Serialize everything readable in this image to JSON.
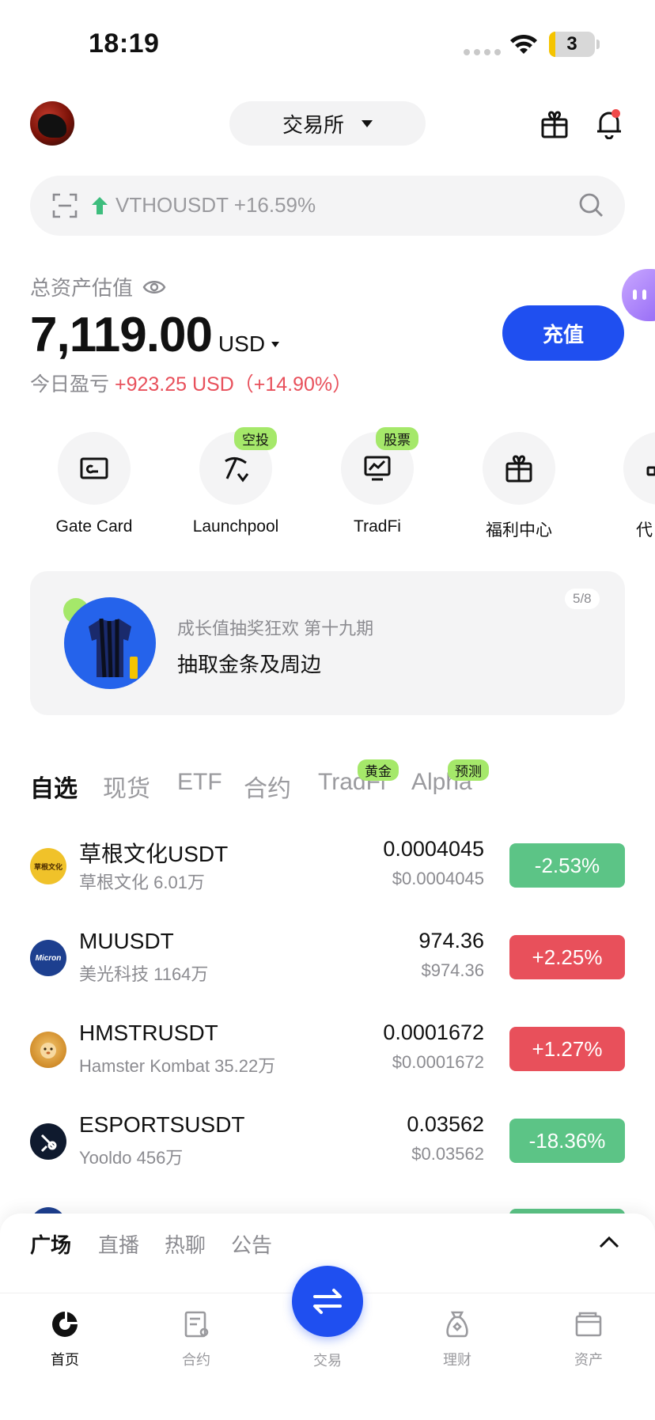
{
  "status_bar": {
    "time": "18:19",
    "battery": "3"
  },
  "header": {
    "exchange_label": "交易所"
  },
  "search": {
    "trending_text": "VTHOUSDT +16.59%"
  },
  "assets": {
    "label": "总资产估值",
    "amount": "7,119.00",
    "currency": "USD",
    "pnl_label": "今日盈亏",
    "pnl_value": "+923.25 USD（+14.90%）",
    "deposit_label": "充值"
  },
  "shortcuts": [
    {
      "label": "Gate Card",
      "icon": "card-icon",
      "badge": ""
    },
    {
      "label": "Launchpool",
      "icon": "pickaxe-icon",
      "badge": "空投"
    },
    {
      "label": "TradFi",
      "icon": "chart-monitor-icon",
      "badge": "股票"
    },
    {
      "label": "福利中心",
      "icon": "gift-icon",
      "badge": ""
    },
    {
      "label": "代",
      "icon": "grid-icon",
      "badge": ""
    }
  ],
  "banner": {
    "subtitle": "成长值抽奖狂欢 第十九期",
    "title": "抽取金条及周边",
    "pager": "5/8"
  },
  "market_tabs": [
    {
      "label": "自选",
      "badge": ""
    },
    {
      "label": "现货",
      "badge": ""
    },
    {
      "label": "ETF",
      "badge": ""
    },
    {
      "label": "合约",
      "badge": ""
    },
    {
      "label": "TradFi",
      "badge": "黄金"
    },
    {
      "label": "Alpha",
      "badge": "预测"
    }
  ],
  "market_rows": [
    {
      "symbol": "草根文化USDT",
      "sub": "草根文化 6.01万",
      "price": "0.0004045",
      "price_usd": "$0.0004045",
      "change": "-2.53%",
      "logo_text": "草根文化"
    },
    {
      "symbol": "MUUSDT",
      "sub": "美光科技 1164万",
      "price": "974.36",
      "price_usd": "$974.36",
      "change": "+2.25%",
      "logo_text": "Micron"
    },
    {
      "symbol": "HMSTRUSDT",
      "sub": "Hamster Kombat 35.22万",
      "price": "0.0001672",
      "price_usd": "$0.0001672",
      "change": "+1.27%",
      "logo_text": ""
    },
    {
      "symbol": "ESPORTSUSDT",
      "sub": "Yooldo 456万",
      "price": "0.03562",
      "price_usd": "$0.03562",
      "change": "-18.36%",
      "logo_text": ""
    }
  ],
  "community_tabs": [
    "广场",
    "直播",
    "热聊",
    "公告"
  ],
  "bottom_nav": [
    {
      "label": "首页",
      "icon": "home-icon"
    },
    {
      "label": "合约",
      "icon": "contract-icon"
    },
    {
      "label": "交易",
      "icon": "swap-icon"
    },
    {
      "label": "理财",
      "icon": "finance-bag-icon"
    },
    {
      "label": "资产",
      "icon": "wallet-icon"
    }
  ],
  "colors": {
    "accent": "#1f4ff0",
    "up": "#e8505b",
    "down": "#5cc486",
    "badge": "#a5e86a"
  }
}
